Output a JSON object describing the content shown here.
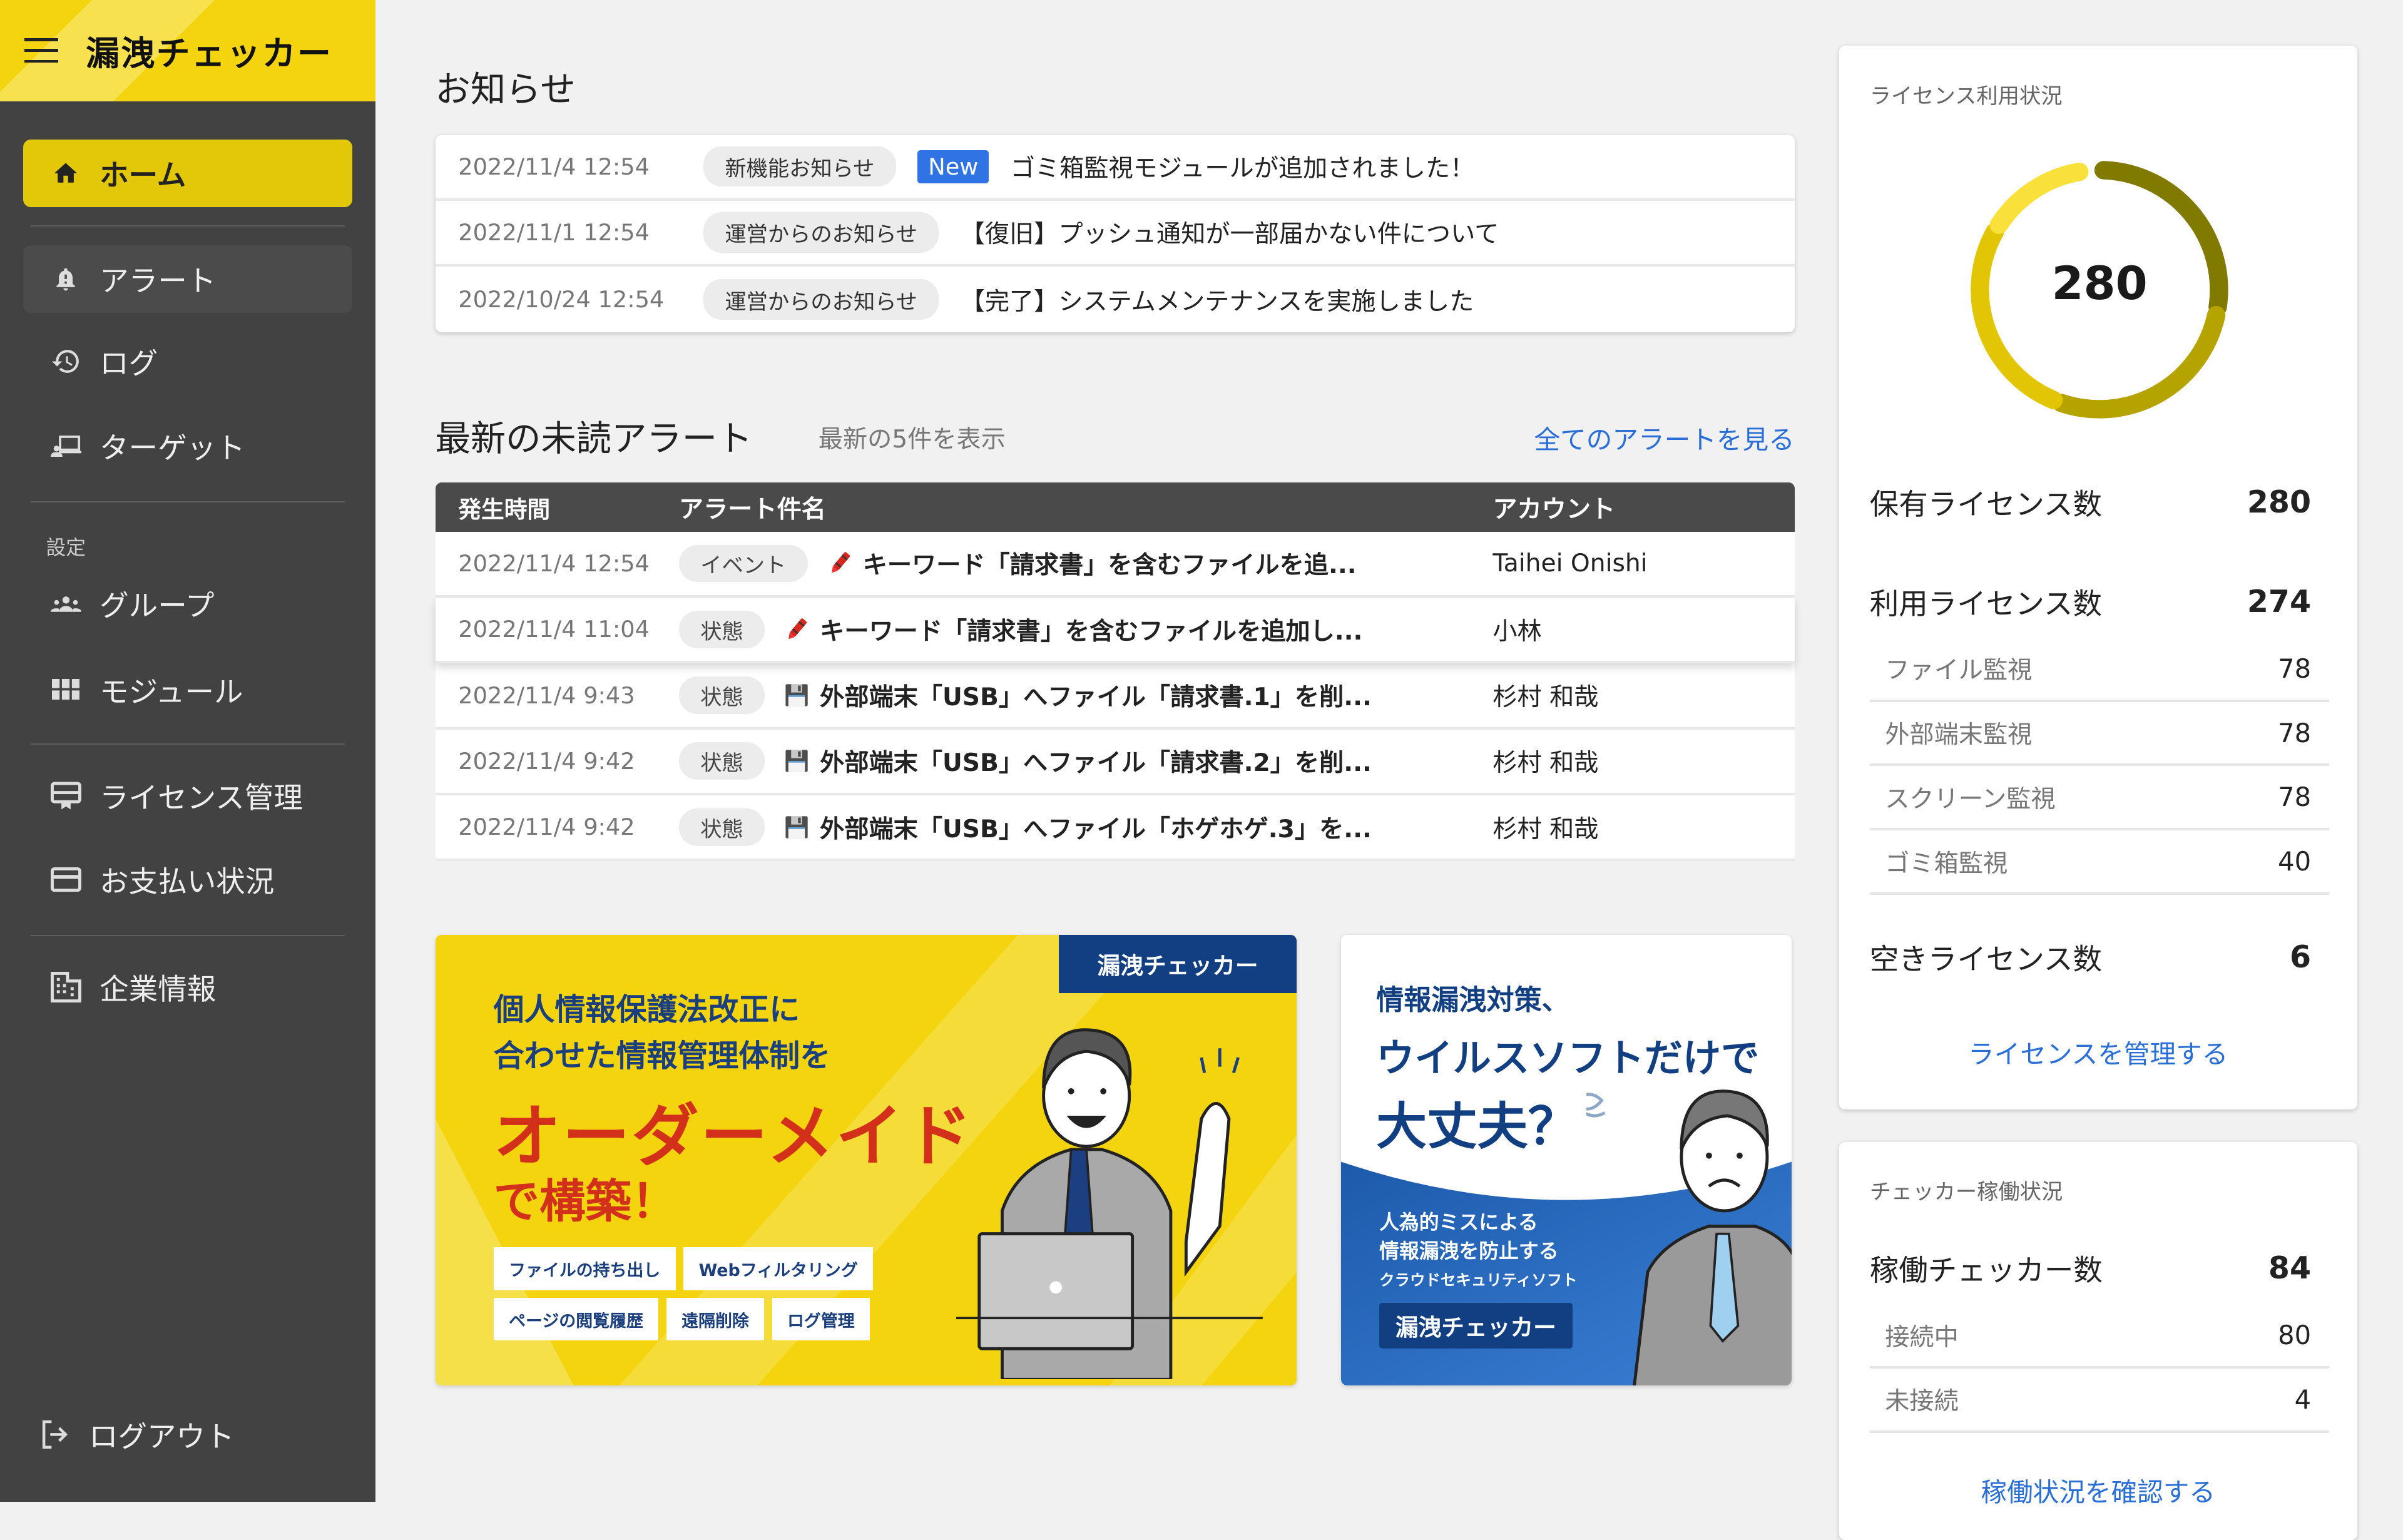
{
  "app": {
    "title": "漏洩チェッカー"
  },
  "sidebar": {
    "items": [
      {
        "label": "ホーム",
        "icon": "home-icon",
        "active": true
      },
      {
        "label": "アラート",
        "icon": "bell-alert-icon"
      },
      {
        "label": "ログ",
        "icon": "history-icon"
      },
      {
        "label": "ターゲット",
        "icon": "target-device-icon"
      },
      {
        "label": "グループ",
        "icon": "group-icon"
      },
      {
        "label": "モジュール",
        "icon": "grid-icon"
      },
      {
        "label": "ライセンス管理",
        "icon": "license-icon"
      },
      {
        "label": "お支払い状況",
        "icon": "credit-card-icon"
      },
      {
        "label": "企業情報",
        "icon": "building-icon"
      }
    ],
    "section_settings": "設定",
    "logout": "ログアウト"
  },
  "news": {
    "title": "お知らせ",
    "items": [
      {
        "date": "2022/11/4 12:54",
        "category": "新機能お知らせ",
        "badge": "New",
        "text": "ゴミ箱監視モジュールが追加されました！"
      },
      {
        "date": "2022/11/1 12:54",
        "category": "運営からのお知らせ",
        "text": "【復旧】プッシュ通知が一部届かない件について"
      },
      {
        "date": "2022/10/24 12:54",
        "category": "運営からのお知らせ",
        "text": "【完了】システムメンテナンスを実施しました"
      }
    ]
  },
  "alerts": {
    "title": "最新の未読アラート",
    "subtitle": "最新の5件を表示",
    "view_all": "全てのアラートを見る",
    "columns": [
      "発生時間",
      "アラート件名",
      "アカウント"
    ],
    "rows": [
      {
        "time": "2022/11/4 12:54",
        "type": "イベント",
        "icon": "crayon-icon",
        "title": "キーワード「請求書」を含むファイルを追...",
        "account": "Taihei Onishi"
      },
      {
        "time": "2022/11/4 11:04",
        "type": "状態",
        "icon": "crayon-icon",
        "title": "キーワード「請求書」を含むファイルを追加し...",
        "account": "小林"
      },
      {
        "time": "2022/11/4 9:43",
        "type": "状態",
        "icon": "floppy-disk-icon",
        "title": "外部端末「USB」へファイル「請求書.1」を削...",
        "account": "杉村 和哉"
      },
      {
        "time": "2022/11/4 9:42",
        "type": "状態",
        "icon": "floppy-disk-icon",
        "title": "外部端末「USB」へファイル「請求書.2」を削...",
        "account": "杉村 和哉"
      },
      {
        "time": "2022/11/4 9:42",
        "type": "状態",
        "icon": "floppy-disk-icon",
        "title": "外部端末「USB」へファイル「ホゲホゲ.3」を...",
        "account": "杉村 和哉"
      }
    ]
  },
  "banner1": {
    "brand": "漏洩チェッカー",
    "line1": "個人情報保護法改正に",
    "line2": "合わせた情報管理体制を",
    "headline": "オーダーメイド",
    "line3": "で構築！",
    "tags": [
      "ファイルの持ち出し",
      "Webフィルタリング",
      "ページの閲覧履歴",
      "遠隔削除",
      "ログ管理"
    ]
  },
  "banner2": {
    "line1": "情報漏洩対策、",
    "line2": "ウイルスソフトだけで",
    "line3": "大丈夫？",
    "sub1": "人為的ミスによる",
    "sub2": "情報漏洩を防止する",
    "sub3": "クラウドセキュリティソフト",
    "brand": "漏洩チェッカー"
  },
  "license": {
    "title": "ライセンス利用状況",
    "total_center": "280",
    "owned_label": "保有ライセンス数",
    "owned": "280",
    "used_label": "利用ライセンス数",
    "used": "274",
    "breakdown": [
      {
        "label": "ファイル監視",
        "value": "78"
      },
      {
        "label": "外部端末監視",
        "value": "78"
      },
      {
        "label": "スクリーン監視",
        "value": "78"
      },
      {
        "label": "ゴミ箱監視",
        "value": "40"
      }
    ],
    "free_label": "空きライセンス数",
    "free": "6",
    "manage_link": "ライセンスを管理する",
    "donut": {
      "total": 280,
      "segments": [
        {
          "name": "ファイル監視",
          "value": 78,
          "color": "#817a00"
        },
        {
          "name": "外部端末監視",
          "value": 78,
          "color": "#b5a300"
        },
        {
          "name": "スクリーン監視",
          "value": 78,
          "color": "#e2c605"
        },
        {
          "name": "ゴミ箱監視",
          "value": 40,
          "color": "#f9e03a"
        }
      ]
    }
  },
  "checker": {
    "title": "チェッカー稼働状況",
    "running_label": "稼働チェッカー数",
    "running": "84",
    "breakdown": [
      {
        "label": "接続中",
        "value": "80"
      },
      {
        "label": "未接続",
        "value": "4"
      }
    ],
    "link": "稼働状況を確認する"
  }
}
